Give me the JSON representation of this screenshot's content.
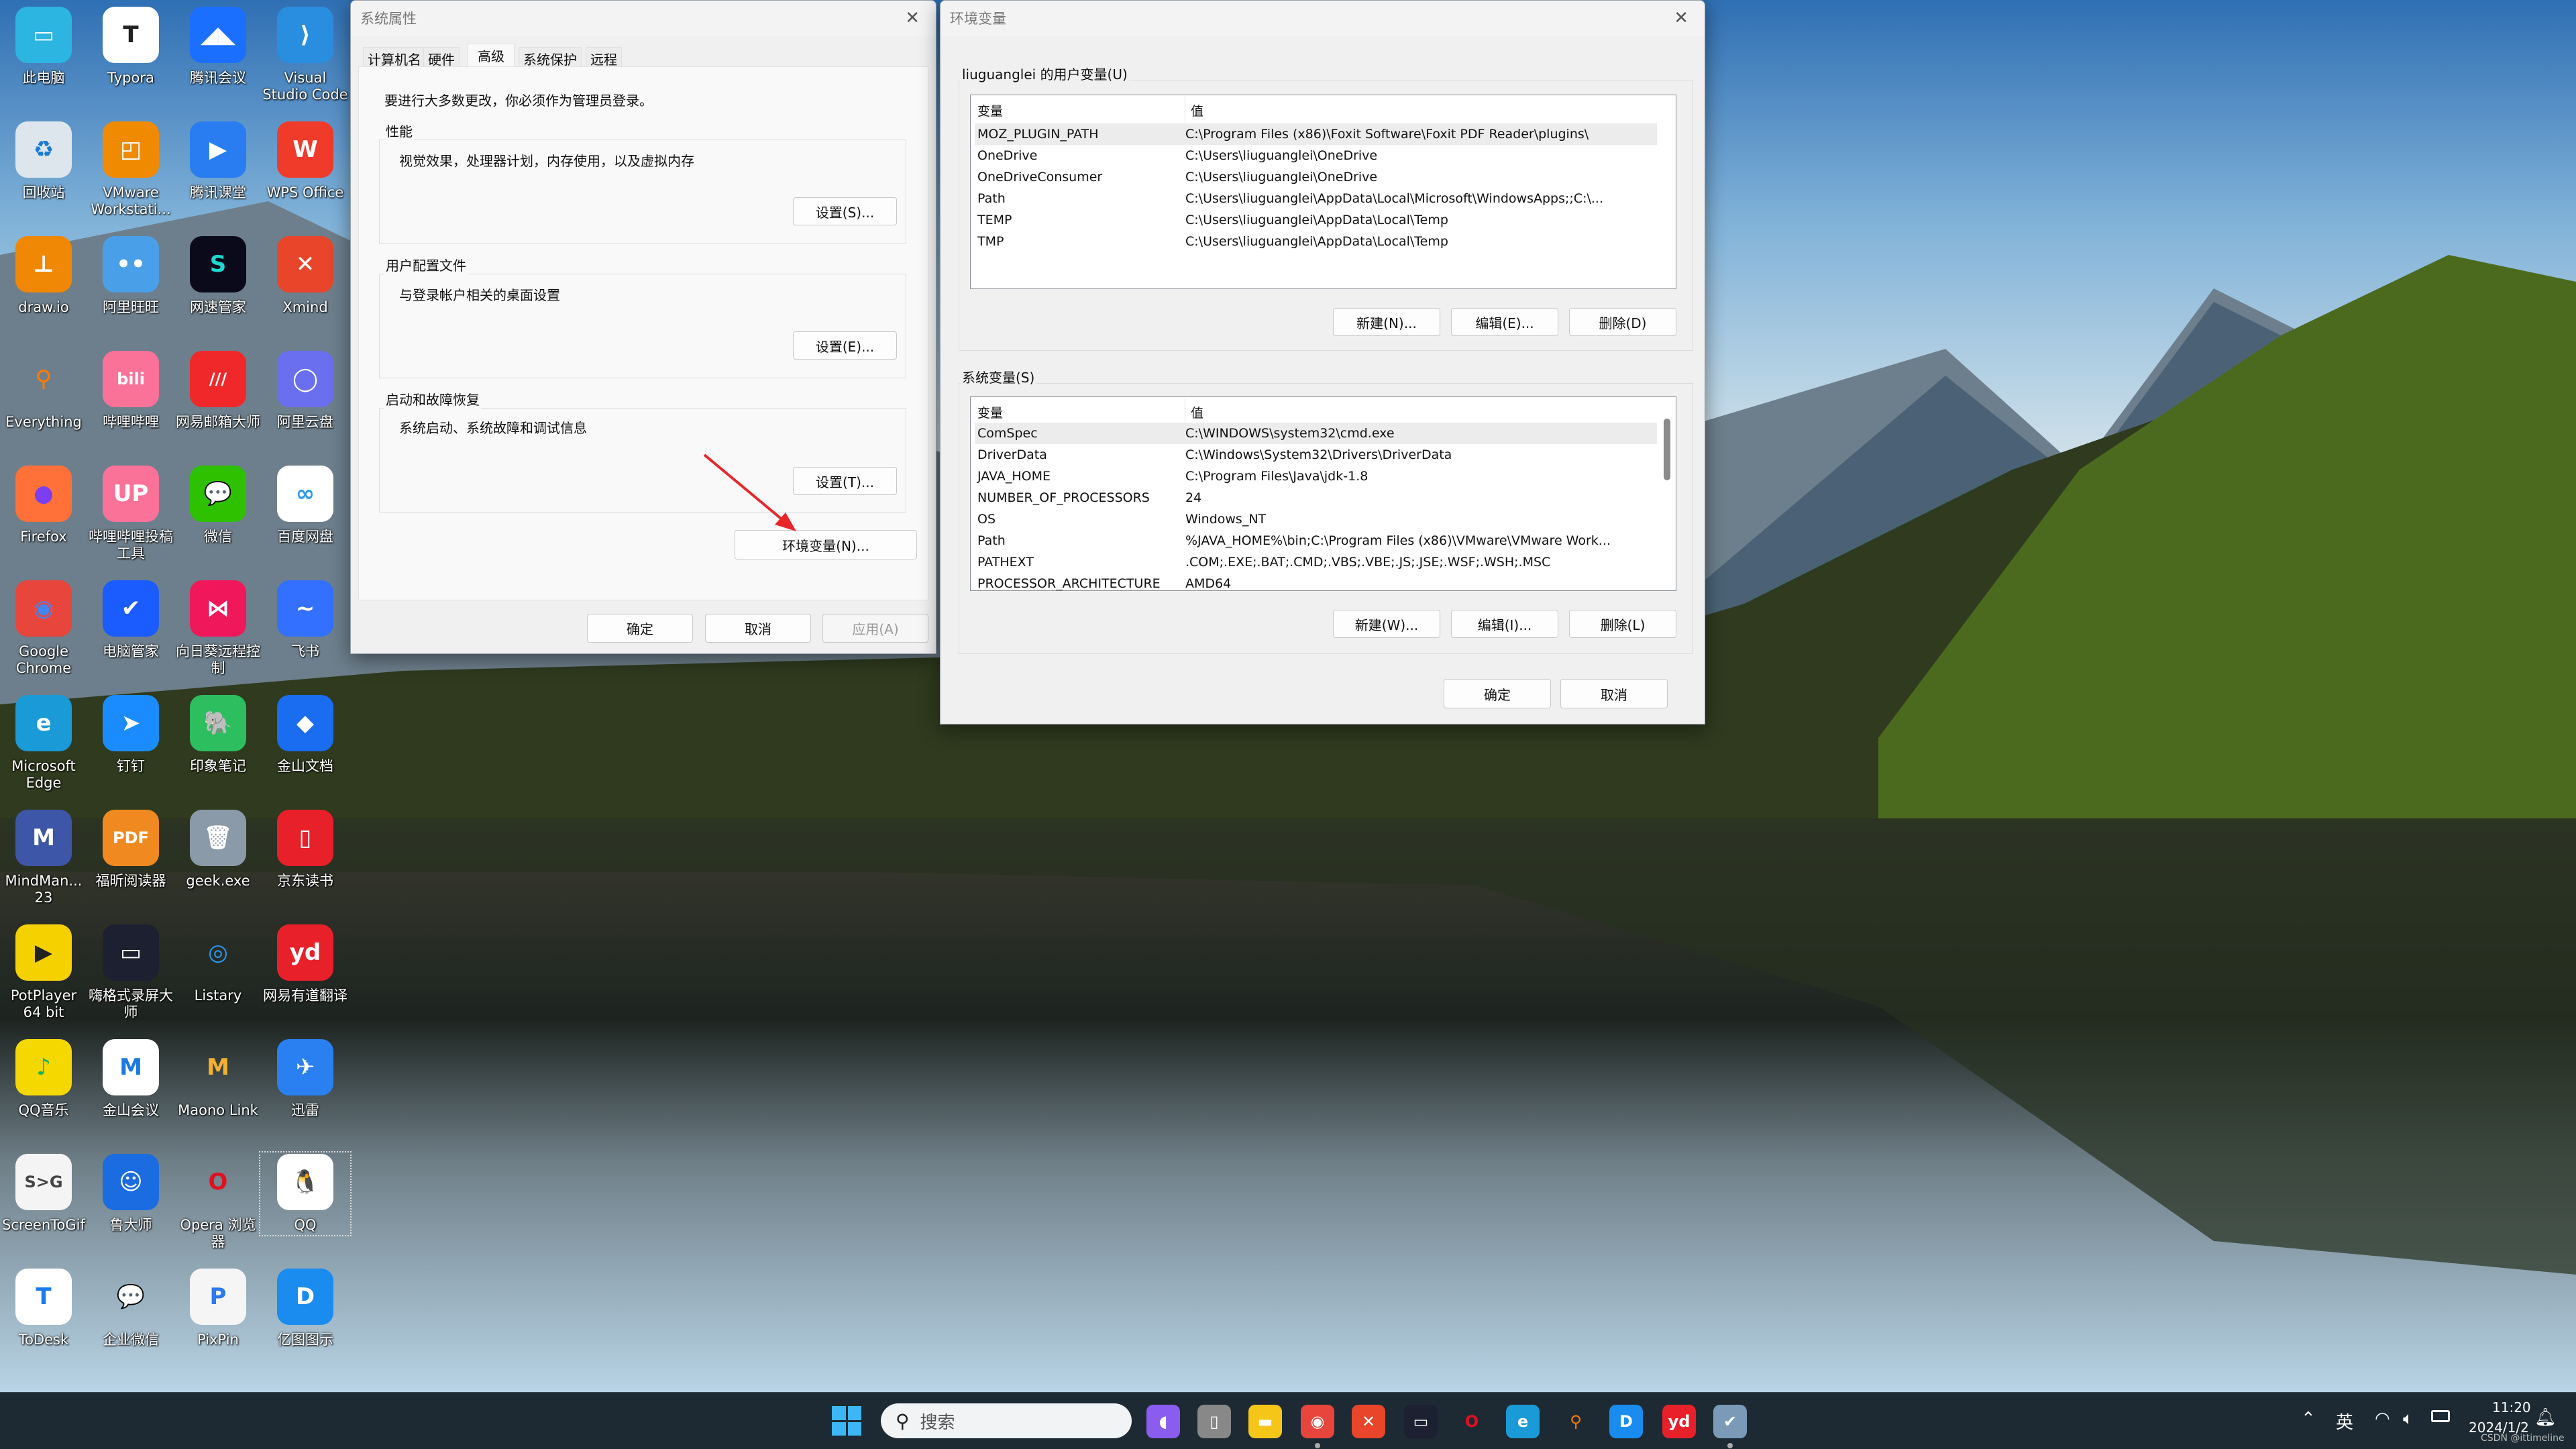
{
  "desktop": {
    "icons": [
      {
        "label": "此电脑",
        "icon": "this-pc-icon",
        "color": "#2bb5e0",
        "glyph": "▭"
      },
      {
        "label": "Typora",
        "icon": "typora-icon",
        "color": "#ffffff",
        "glyph": "T",
        "fg": "#222"
      },
      {
        "label": "腾讯会议",
        "icon": "tencent-meeting-icon",
        "color": "#1a6fff",
        "glyph": "◢◣"
      },
      {
        "label": "Visual Studio Code",
        "icon": "vscode-icon",
        "color": "#2a8ee0",
        "glyph": "⟩"
      },
      {
        "label": "回收站",
        "icon": "recycle-bin-icon",
        "color": "#dde6ec",
        "glyph": "♻",
        "fg": "#1a7ad6"
      },
      {
        "label": "VMware Workstati...",
        "icon": "vmware-icon",
        "color": "#f08a00",
        "glyph": "◰"
      },
      {
        "label": "腾讯课堂",
        "icon": "tencent-classroom-icon",
        "color": "#2a7df0",
        "glyph": "▶"
      },
      {
        "label": "WPS Office",
        "icon": "wps-icon",
        "color": "#f03a2a",
        "glyph": "W"
      },
      {
        "label": "draw.io",
        "icon": "drawio-icon",
        "color": "#f08705",
        "glyph": "⊥"
      },
      {
        "label": "阿里旺旺",
        "icon": "aliwangwang-icon",
        "color": "#4aa0e8",
        "glyph": "••"
      },
      {
        "label": "网速管家",
        "icon": "netspeed-icon",
        "color": "#0a0a1a",
        "glyph": "S",
        "fg": "#1ed8d0"
      },
      {
        "label": "Xmind",
        "icon": "xmind-icon",
        "color": "#e8452a",
        "glyph": "✕"
      },
      {
        "label": "Everything",
        "icon": "everything-icon",
        "color": "transparent",
        "glyph": "⚲",
        "fg": "#ff7a00"
      },
      {
        "label": "哔哩哔哩",
        "icon": "bilibili-icon",
        "color": "#fb7299",
        "glyph": "bili"
      },
      {
        "label": "网易邮箱大师",
        "icon": "netease-mail-icon",
        "color": "#f0282a",
        "glyph": "///"
      },
      {
        "label": "阿里云盘",
        "icon": "aliyun-drive-icon",
        "color": "#6a6ff0",
        "glyph": "◯"
      },
      {
        "label": "Firefox",
        "icon": "firefox-icon",
        "color": "#ff7139",
        "glyph": "●",
        "fg": "#7b3ff0"
      },
      {
        "label": "哔哩哔哩投稿工具",
        "icon": "bilibili-upload-icon",
        "color": "#fb7299",
        "glyph": "UP"
      },
      {
        "label": "微信",
        "icon": "wechat-icon",
        "color": "#2dc100",
        "glyph": "💬"
      },
      {
        "label": "百度网盘",
        "icon": "baidu-netdisk-icon",
        "color": "#ffffff",
        "glyph": "∞",
        "fg": "#2a9af0"
      },
      {
        "label": "Google Chrome",
        "icon": "chrome-icon",
        "color": "#e8453c",
        "glyph": "◉",
        "fg": "#4285f4"
      },
      {
        "label": "电脑管家",
        "icon": "pc-manager-icon",
        "color": "#1a5cff",
        "glyph": "✔"
      },
      {
        "label": "向日葵远程控制",
        "icon": "sunlogin-icon",
        "color": "#f0185a",
        "glyph": "⋈"
      },
      {
        "label": "飞书",
        "icon": "feishu-icon",
        "color": "#3370ff",
        "glyph": "~"
      },
      {
        "label": "Microsoft Edge",
        "icon": "edge-icon",
        "color": "#1a9ad6",
        "glyph": "e"
      },
      {
        "label": "钉钉",
        "icon": "dingtalk-icon",
        "color": "#1a8cff",
        "glyph": "➤"
      },
      {
        "label": "印象笔记",
        "icon": "evernote-icon",
        "color": "#2dbe60",
        "glyph": "🐘"
      },
      {
        "label": "金山文档",
        "icon": "kdocs-icon",
        "color": "#1a6cf0",
        "glyph": "◆"
      },
      {
        "label": "MindMan... 23",
        "icon": "mindmanager-icon",
        "color": "#3e56a8",
        "glyph": "M"
      },
      {
        "label": "福昕阅读器",
        "icon": "foxit-reader-icon",
        "color": "#f08a20",
        "glyph": "PDF"
      },
      {
        "label": "geek.exe",
        "icon": "geek-uninstaller-icon",
        "color": "#8a9aa8",
        "glyph": "🗑"
      },
      {
        "label": "京东读书",
        "icon": "jd-read-icon",
        "color": "#e8202a",
        "glyph": "▯"
      },
      {
        "label": "PotPlayer 64 bit",
        "icon": "potplayer-icon",
        "color": "#f5d100",
        "glyph": "▶",
        "fg": "#222"
      },
      {
        "label": "嗨格式录屏大师",
        "icon": "screen-recorder-icon",
        "color": "#1c2030",
        "glyph": "▭"
      },
      {
        "label": "Listary",
        "icon": "listary-icon",
        "color": "transparent",
        "glyph": "◎",
        "fg": "#2a9af0"
      },
      {
        "label": "网易有道翻译",
        "icon": "youdao-icon",
        "color": "#e8202a",
        "glyph": "yd"
      },
      {
        "label": "QQ音乐",
        "icon": "qq-music-icon",
        "color": "#f5d800",
        "glyph": "♪",
        "fg": "#1ab060"
      },
      {
        "label": "金山会议",
        "icon": "kingsoft-meeting-icon",
        "color": "#ffffff",
        "glyph": "M",
        "fg": "#1a7ae0"
      },
      {
        "label": "Maono Link",
        "icon": "maono-link-icon",
        "color": "transparent",
        "glyph": "M",
        "fg": "#f5b030"
      },
      {
        "label": "迅雷",
        "icon": "xunlei-icon",
        "color": "#2a80f0",
        "glyph": "✈"
      },
      {
        "label": "ScreenToGif",
        "icon": "screentogif-icon",
        "color": "#f4f4f4",
        "glyph": "S>G",
        "fg": "#444"
      },
      {
        "label": "鲁大师",
        "icon": "ludashi-icon",
        "color": "#1a6ce0",
        "glyph": "☺"
      },
      {
        "label": "Opera 浏览器",
        "icon": "opera-icon",
        "color": "transparent",
        "glyph": "O",
        "fg": "#e01020"
      },
      {
        "label": "QQ",
        "icon": "qq-icon",
        "color": "#ffffff",
        "glyph": "🐧",
        "fg": "#111",
        "selected": true
      },
      {
        "label": "ToDesk",
        "icon": "todesk-icon",
        "color": "#ffffff",
        "glyph": "T",
        "fg": "#1a7af0"
      },
      {
        "label": "企业微信",
        "icon": "wecom-icon",
        "color": "transparent",
        "glyph": "💬",
        "fg": "#2a8cf0"
      },
      {
        "label": "PixPin",
        "icon": "pixpin-icon",
        "color": "#f5f5f5",
        "glyph": "P",
        "fg": "#2a7af0"
      },
      {
        "label": "亿图图示",
        "icon": "edraw-icon",
        "color": "#1a8cf0",
        "glyph": "D"
      }
    ]
  },
  "sysprops": {
    "title": "系统属性",
    "tabs": [
      "计算机名",
      "硬件",
      "高级",
      "系统保护",
      "远程"
    ],
    "active_tab": "高级",
    "admin_note": "要进行大多数更改，你必须作为管理员登录。",
    "groups": [
      {
        "label": "性能",
        "desc": "视觉效果，处理器计划，内存使用，以及虚拟内存",
        "button": "设置(S)..."
      },
      {
        "label": "用户配置文件",
        "desc": "与登录帐户相关的桌面设置",
        "button": "设置(E)..."
      },
      {
        "label": "启动和故障恢复",
        "desc": "系统启动、系统故障和调试信息",
        "button": "设置(T)..."
      }
    ],
    "env_button": "环境变量(N)...",
    "ok": "确定",
    "cancel": "取消",
    "apply": "应用(A)",
    "annotation_color": "#e8262a"
  },
  "envvars": {
    "title": "环境变量",
    "user_group": "liuguanglei 的用户变量(U)",
    "col_var": "变量",
    "col_val": "值",
    "user_vars": [
      {
        "name": "MOZ_PLUGIN_PATH",
        "value": "C:\\Program Files (x86)\\Foxit Software\\Foxit PDF Reader\\plugins\\"
      },
      {
        "name": "OneDrive",
        "value": "C:\\Users\\liuguanglei\\OneDrive"
      },
      {
        "name": "OneDriveConsumer",
        "value": "C:\\Users\\liuguanglei\\OneDrive"
      },
      {
        "name": "Path",
        "value": "C:\\Users\\liuguanglei\\AppData\\Local\\Microsoft\\WindowsApps;;C:\\..."
      },
      {
        "name": "TEMP",
        "value": "C:\\Users\\liuguanglei\\AppData\\Local\\Temp"
      },
      {
        "name": "TMP",
        "value": "C:\\Users\\liuguanglei\\AppData\\Local\\Temp"
      }
    ],
    "user_buttons": [
      "新建(N)...",
      "编辑(E)...",
      "删除(D)"
    ],
    "sys_group": "系统变量(S)",
    "sys_vars": [
      {
        "name": "ComSpec",
        "value": "C:\\WINDOWS\\system32\\cmd.exe"
      },
      {
        "name": "DriverData",
        "value": "C:\\Windows\\System32\\Drivers\\DriverData"
      },
      {
        "name": "JAVA_HOME",
        "value": "C:\\Program Files\\Java\\jdk-1.8"
      },
      {
        "name": "NUMBER_OF_PROCESSORS",
        "value": "24"
      },
      {
        "name": "OS",
        "value": "Windows_NT"
      },
      {
        "name": "Path",
        "value": "%JAVA_HOME%\\bin;C:\\Program Files (x86)\\VMware\\VMware Work..."
      },
      {
        "name": "PATHEXT",
        "value": ".COM;.EXE;.BAT;.CMD;.VBS;.VBE;.JS;.JSE;.WSF;.WSH;.MSC"
      },
      {
        "name": "PROCESSOR_ARCHITECTURE",
        "value": "AMD64"
      }
    ],
    "sys_buttons": [
      "新建(W)...",
      "编辑(I)...",
      "删除(L)"
    ],
    "ok": "确定",
    "cancel": "取消"
  },
  "taskbar": {
    "search_placeholder": "搜索",
    "apps": [
      {
        "icon": "copilot-icon",
        "color": "#8a5cf0",
        "glyph": "◖"
      },
      {
        "icon": "task-view-icon",
        "color": "#888888",
        "glyph": "▯"
      },
      {
        "icon": "file-explorer-icon",
        "color": "#f5c518",
        "glyph": "▬"
      },
      {
        "icon": "chrome-icon",
        "color": "#e8453c",
        "glyph": "◉",
        "running": true
      },
      {
        "icon": "xmind-icon",
        "color": "#e8452a",
        "glyph": "✕"
      },
      {
        "icon": "screen-recorder-icon",
        "color": "#1c2030",
        "glyph": "▭"
      },
      {
        "icon": "opera-icon",
        "color": "transparent",
        "glyph": "O",
        "fg": "#e01020"
      },
      {
        "icon": "edge-icon",
        "color": "#1a9ad6",
        "glyph": "e"
      },
      {
        "icon": "everything-icon",
        "color": "transparent",
        "glyph": "⚲",
        "fg": "#ff7a00"
      },
      {
        "icon": "edraw-icon",
        "color": "#1a8cf0",
        "glyph": "D"
      },
      {
        "icon": "youdao-icon",
        "color": "#e8202a",
        "glyph": "yd"
      },
      {
        "icon": "system-properties-icon",
        "color": "#7a9ab8",
        "glyph": "✔",
        "running": true
      }
    ],
    "ime": "英",
    "time": "11:20",
    "date": "2024/1/2",
    "watermark": "CSDN @ittimeline"
  }
}
